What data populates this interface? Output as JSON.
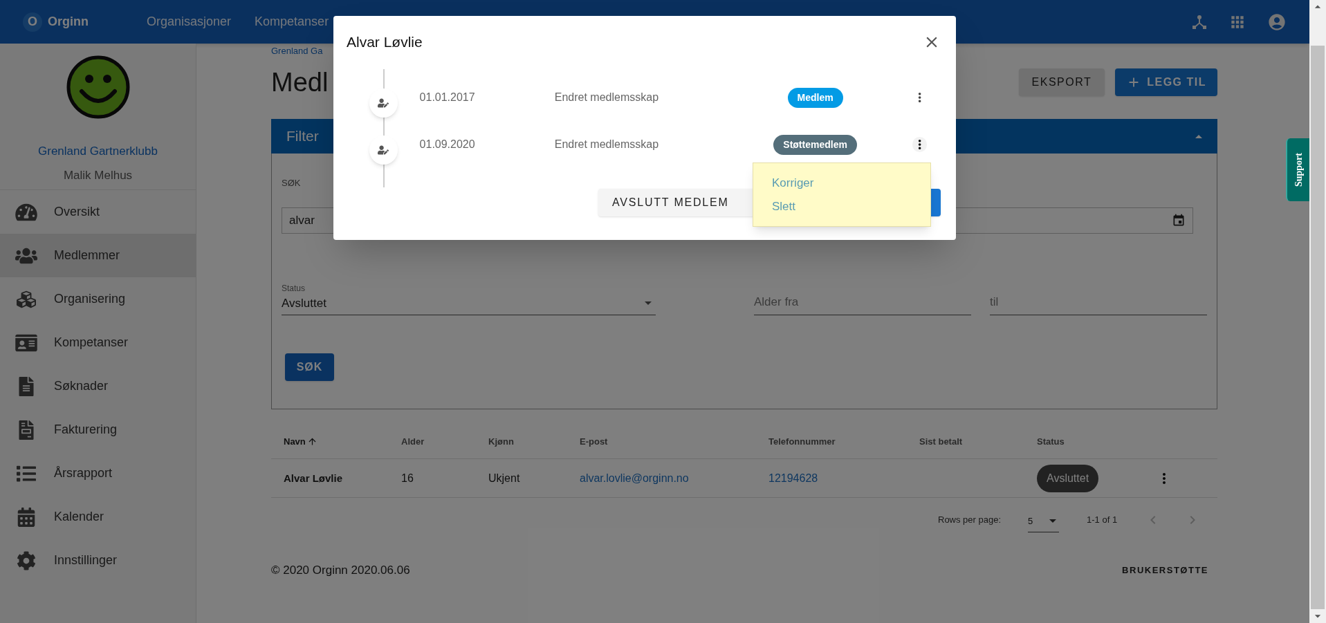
{
  "top_bar": {
    "logo_letter": "O",
    "brand": "Orginn",
    "nav": [
      {
        "label": "Organisasjoner"
      },
      {
        "label": "Kompetanser"
      }
    ]
  },
  "sidebar": {
    "club": "Grenland Gartnerklubb",
    "user": "Malik Melhus",
    "items": [
      {
        "label": "Oversikt",
        "selected": false
      },
      {
        "label": "Medlemmer",
        "selected": true
      },
      {
        "label": "Organisering",
        "selected": false
      },
      {
        "label": "Kompetanser",
        "selected": false
      },
      {
        "label": "Søknader",
        "selected": false
      },
      {
        "label": "Fakturering",
        "selected": false
      },
      {
        "label": "Årsrapport",
        "selected": false
      },
      {
        "label": "Kalender",
        "selected": false
      },
      {
        "label": "Innstillinger",
        "selected": false
      }
    ]
  },
  "breadcrumb": "Grenland Ga",
  "heading": "Medl",
  "actions": [
    {
      "label": "EKSPORT",
      "kind": "secondary"
    },
    {
      "label": "LEGG TIL",
      "kind": "primary"
    }
  ],
  "filter": {
    "title": "Filter",
    "expanded": true,
    "search_label": "SØK",
    "search_value": "alvar",
    "status_label": "Status",
    "status_value": "Avsluttet",
    "age_from_placeholder": "Alder fra",
    "age_to_placeholder": "til",
    "submit": "SØK"
  },
  "table": {
    "columns": [
      {
        "label": "Navn",
        "sorted": true
      },
      {
        "label": "Alder",
        "sorted": false
      },
      {
        "label": "Kjønn",
        "sorted": false
      },
      {
        "label": "E-post",
        "sorted": false
      },
      {
        "label": "Telefonnummer",
        "sorted": false
      },
      {
        "label": "Sist betalt",
        "sorted": false
      },
      {
        "label": "Status",
        "sorted": false
      }
    ],
    "rows": [
      {
        "name": "Alvar Løvlie",
        "age": "16",
        "gender": "Ukjent",
        "email": "alvar.lovlie@orginn.no",
        "phone": "12194628",
        "status": "Avsluttet"
      }
    ]
  },
  "pagination": {
    "rows_per_page_label": "Rows per page:",
    "rows_per_page": "5",
    "range": "1-1 of 1"
  },
  "footer": {
    "copyright": "© 2020 Orginn 2020.06.06",
    "support_link": "BRUKERSTØTTE"
  },
  "support_tab": "Support",
  "dialog": {
    "title": "Alvar Løvlie",
    "entries": [
      {
        "date": "01.01.2017",
        "text": "Endret medlemsskap",
        "badge": "Medlem",
        "color": "#039be5",
        "menu_open": false
      },
      {
        "date": "01.09.2020",
        "text": "Endret medlemsskap",
        "badge": "Støttemedlem",
        "color": "#546e7a",
        "menu_open": true
      }
    ],
    "menu_items": [
      "Korriger",
      "Slett"
    ],
    "end_button": "AVSLUTT MEDLEM"
  }
}
